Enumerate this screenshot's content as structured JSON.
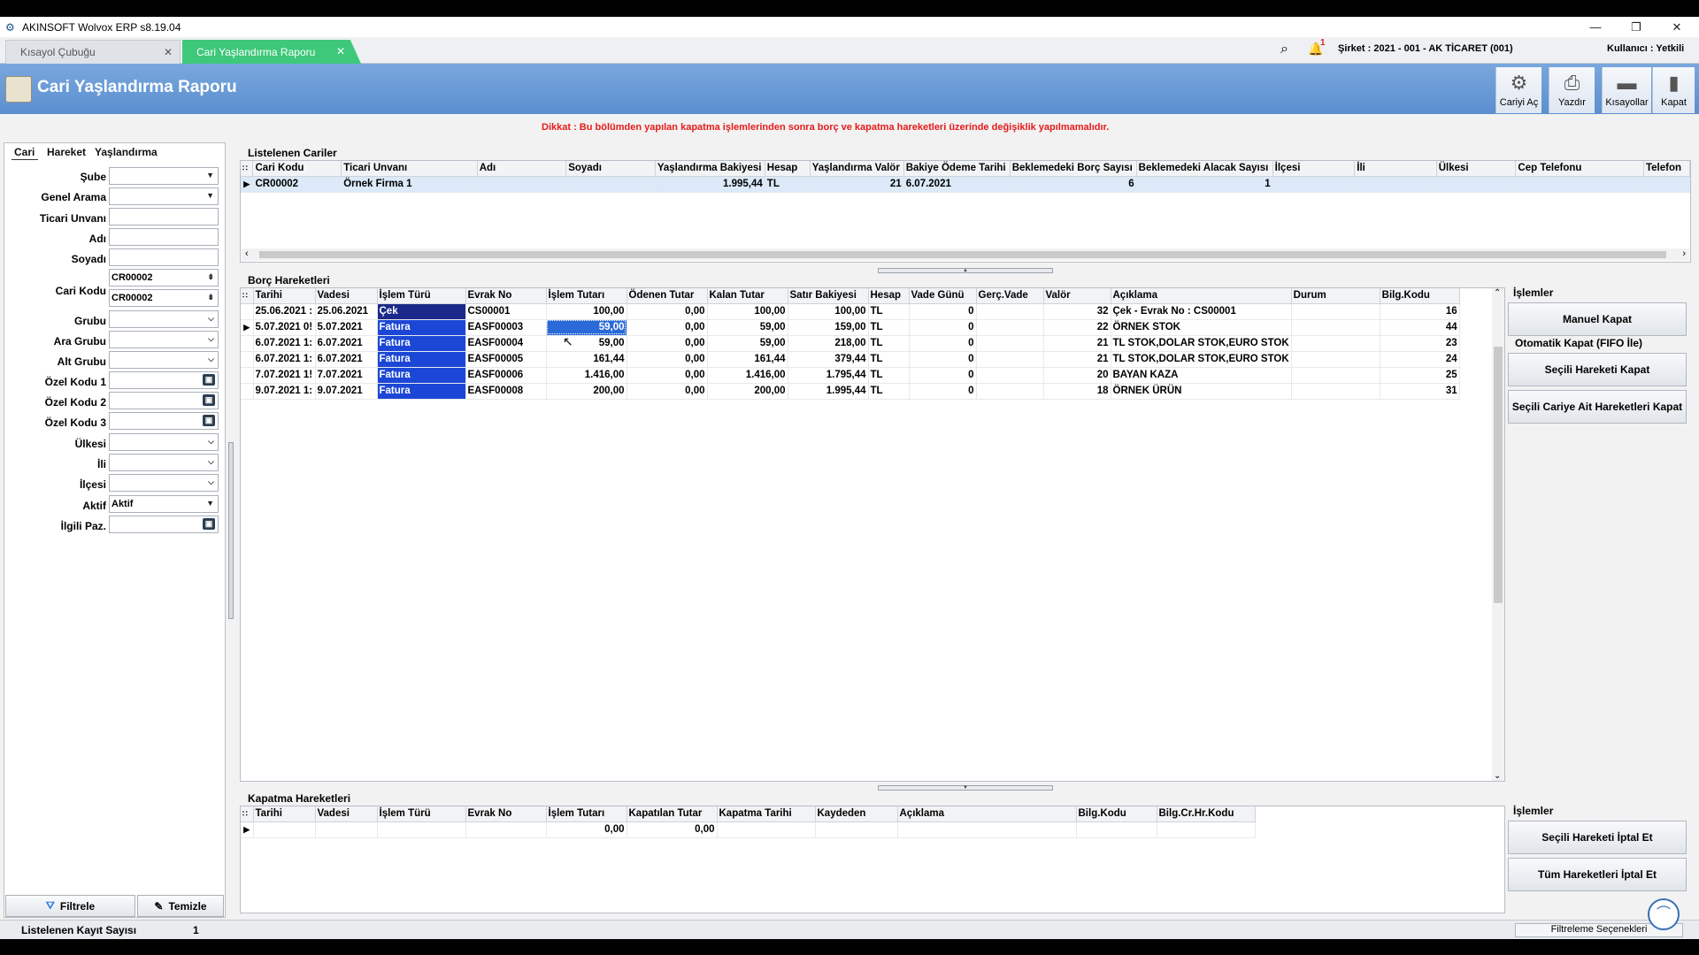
{
  "window": {
    "title": "AKINSOFT Wolvox ERP s8.19.04",
    "minimize": "—",
    "maximize": "❐",
    "close": "✕"
  },
  "tabs": [
    {
      "label": "Kısayol Çubuğu"
    },
    {
      "label": "Cari Yaşlandırma Raporu"
    }
  ],
  "topbar": {
    "notification_count": "1",
    "company": "Şirket : 2021 - 001 - AK TİCARET (001)",
    "user": "Kullanıcı : Yetkili"
  },
  "header": {
    "title": "Cari Yaşlandırma Raporu"
  },
  "toolbar": [
    {
      "label": "Cariyi Aç",
      "icon": "open-account-icon"
    },
    {
      "label": "Yazdır",
      "icon": "printer-icon"
    },
    {
      "label": "Kısayollar",
      "icon": "shortcuts-icon"
    },
    {
      "label": "Kapat",
      "icon": "door-exit-icon"
    }
  ],
  "warning": "Dikkat : Bu bölümden yapılan kapatma işlemlerinden sonra borç ve kapatma hareketleri üzerinde değişiklik yapılmamalıdır.",
  "left_tabs": [
    "Cari",
    "Hareket",
    "Yaşlandırma"
  ],
  "filters": {
    "sube": {
      "label": "Şube",
      "value": ""
    },
    "genel_arama": {
      "label": "Genel Arama",
      "value": ""
    },
    "ticari_unvani": {
      "label": "Ticari Unvanı",
      "value": ""
    },
    "adi": {
      "label": "Adı",
      "value": ""
    },
    "soyadi": {
      "label": "Soyadı",
      "value": ""
    },
    "cari_kodu": {
      "label": "Cari Kodu",
      "value1": "CR00002",
      "value2": "CR00002"
    },
    "grubu": {
      "label": "Grubu",
      "value": ""
    },
    "ara_grubu": {
      "label": "Ara Grubu",
      "value": ""
    },
    "alt_grubu": {
      "label": "Alt Grubu",
      "value": ""
    },
    "ozel_kodu_1": {
      "label": "Özel Kodu 1",
      "value": ""
    },
    "ozel_kodu_2": {
      "label": "Özel Kodu 2",
      "value": ""
    },
    "ozel_kodu_3": {
      "label": "Özel Kodu 3",
      "value": ""
    },
    "ulkesi": {
      "label": "Ülkesi",
      "value": ""
    },
    "ili": {
      "label": "İli",
      "value": ""
    },
    "ilcesi": {
      "label": "İlçesi",
      "value": ""
    },
    "aktif": {
      "label": "Aktif",
      "value": "Aktif"
    },
    "ilgili_paz": {
      "label": "İlgili Paz.",
      "value": ""
    }
  },
  "left_buttons": {
    "filter": "Filtrele",
    "clear": "Temizle"
  },
  "listed_accounts": {
    "title": "Listelenen Cariler",
    "columns": [
      "Cari Kodu",
      "Ticari Unvanı",
      "Adı",
      "Soyadı",
      "Yaşlandırma Bakiyesi",
      "Hesap",
      "Yaşlandırma Valör",
      "Bakiye Ödeme Tarihi",
      "Beklemedeki Borç Sayısı",
      "Beklemedeki Alacak Sayısı",
      "İlçesi",
      "İli",
      "Ülkesi",
      "Cep Telefonu",
      "Telefon"
    ],
    "rows": [
      [
        "CR00002",
        "Örnek Firma 1",
        "",
        "",
        "1.995,44",
        "TL",
        "21",
        "6.07.2021",
        "6",
        "1",
        "",
        "",
        "",
        "",
        ""
      ]
    ]
  },
  "debt_movements": {
    "title": "Borç Hareketleri",
    "columns": [
      "Tarihi",
      "Vadesi",
      "İşlem Türü",
      "Evrak No",
      "İşlem Tutarı",
      "Ödenen Tutar",
      "Kalan Tutar",
      "Satır Bakiyesi",
      "Hesap",
      "Vade Günü",
      "Gerç.Vade",
      "Valör",
      "Açıklama",
      "Durum",
      "Bilg.Kodu"
    ],
    "rows": [
      [
        "25.06.2021 :",
        "25.06.2021",
        "Çek",
        "CS00001",
        "100,00",
        "0,00",
        "100,00",
        "100,00",
        "TL",
        "0",
        "",
        "32",
        "Çek - Evrak No : CS00001",
        "",
        "16"
      ],
      [
        "5.07.2021 0!",
        "5.07.2021",
        "Fatura",
        "EASF00003",
        "59,00",
        "0,00",
        "59,00",
        "159,00",
        "TL",
        "0",
        "",
        "22",
        "ÖRNEK STOK",
        "",
        "44"
      ],
      [
        "6.07.2021 1:",
        "6.07.2021",
        "Fatura",
        "EASF00004",
        "59,00",
        "0,00",
        "59,00",
        "218,00",
        "TL",
        "0",
        "",
        "21",
        "TL STOK,DOLAR STOK,EURO STOK",
        "",
        "23"
      ],
      [
        "6.07.2021 1:",
        "6.07.2021",
        "Fatura",
        "EASF00005",
        "161,44",
        "0,00",
        "161,44",
        "379,44",
        "TL",
        "0",
        "",
        "21",
        "TL STOK,DOLAR STOK,EURO STOK",
        "",
        "24"
      ],
      [
        "7.07.2021 1!",
        "7.07.2021",
        "Fatura",
        "EASF00006",
        "1.416,00",
        "0,00",
        "1.416,00",
        "1.795,44",
        "TL",
        "0",
        "",
        "20",
        "BAYAN KAZA",
        "",
        "25"
      ],
      [
        "9.07.2021 1:",
        "9.07.2021",
        "Fatura",
        "EASF00008",
        "200,00",
        "0,00",
        "200,00",
        "1.995,44",
        "TL",
        "0",
        "",
        "18",
        "ÖRNEK ÜRÜN",
        "",
        "31"
      ]
    ]
  },
  "right_ops_1": {
    "title": "İşlemler",
    "manual": "Manuel Kapat",
    "auto_title": "Otomatik Kapat (FIFO İle)",
    "selected": "Seçili Hareketi Kapat",
    "account": "Seçili Cariye Ait Hareketleri Kapat"
  },
  "closing_movements": {
    "title": "Kapatma Hareketleri",
    "columns": [
      "Tarihi",
      "Vadesi",
      "İşlem Türü",
      "Evrak No",
      "İşlem Tutarı",
      "Kapatılan Tutar",
      "Kapatma Tarihi",
      "Kaydeden",
      "Açıklama",
      "Bilg.Kodu",
      "Bilg.Cr.Hr.Kodu"
    ],
    "rows": [
      [
        "",
        "",
        "",
        "",
        "0,00",
        "0,00",
        "",
        "",
        "",
        "",
        ""
      ]
    ]
  },
  "right_ops_2": {
    "title": "İşlemler",
    "cancel_selected": "Seçili Hareketi İptal Et",
    "cancel_all": "Tüm Hareketleri İptal Et"
  },
  "status": {
    "count_label": "Listelenen Kayıt Sayısı",
    "count_value": "1",
    "filter_options": "Filtreleme Seçenekleri"
  }
}
